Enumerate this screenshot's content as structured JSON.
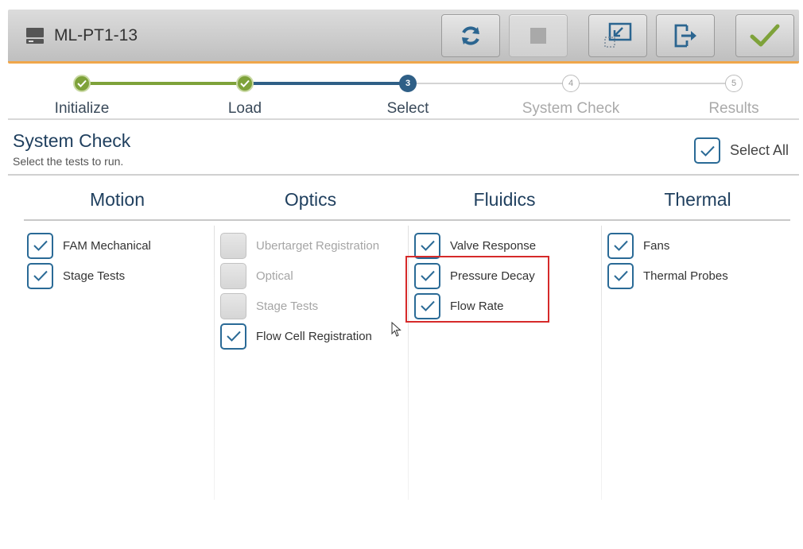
{
  "device": {
    "name": "ML-PT1-13",
    "icon": "device-icon"
  },
  "toolbar": {
    "buttons": [
      {
        "name": "refresh",
        "icon": "refresh-icon"
      },
      {
        "name": "stop",
        "icon": "stop-icon",
        "disabled": true
      },
      {
        "name": "minimize",
        "icon": "minimize-window-icon"
      },
      {
        "name": "exit",
        "icon": "exit-icon"
      },
      {
        "name": "confirm",
        "icon": "checkmark-icon"
      }
    ]
  },
  "stepper": {
    "steps": [
      {
        "number": "1",
        "label": "Initialize",
        "state": "done"
      },
      {
        "number": "2",
        "label": "Load",
        "state": "done"
      },
      {
        "number": "3",
        "label": "Select",
        "state": "active"
      },
      {
        "number": "4",
        "label": "System Check",
        "state": "todo"
      },
      {
        "number": "5",
        "label": "Results",
        "state": "todo"
      }
    ]
  },
  "section": {
    "title": "System Check",
    "subtitle": "Select the tests to run.",
    "select_all_label": "Select All",
    "select_all_checked": true
  },
  "colors": {
    "accent": "#2a6a96",
    "heading": "#1f3f5e",
    "done": "#7ea23a",
    "highlight": "#d62a2a"
  },
  "columns": [
    {
      "title": "Motion",
      "items": [
        {
          "label": "FAM Mechanical",
          "checked": true,
          "disabled": false
        },
        {
          "label": "Stage Tests",
          "checked": true,
          "disabled": false
        }
      ]
    },
    {
      "title": "Optics",
      "items": [
        {
          "label": "Ubertarget Registration",
          "checked": false,
          "disabled": true
        },
        {
          "label": "Optical",
          "checked": false,
          "disabled": true
        },
        {
          "label": "Stage Tests",
          "checked": false,
          "disabled": true
        },
        {
          "label": "Flow Cell Registration",
          "checked": true,
          "disabled": false
        }
      ]
    },
    {
      "title": "Fluidics",
      "items": [
        {
          "label": "Valve Response",
          "checked": true,
          "disabled": false
        },
        {
          "label": "Pressure Decay",
          "checked": true,
          "disabled": false
        },
        {
          "label": "Flow Rate",
          "checked": true,
          "disabled": false
        }
      ]
    },
    {
      "title": "Thermal",
      "items": [
        {
          "label": "Fans",
          "checked": true,
          "disabled": false
        },
        {
          "label": "Thermal Probes",
          "checked": true,
          "disabled": false
        }
      ]
    }
  ]
}
